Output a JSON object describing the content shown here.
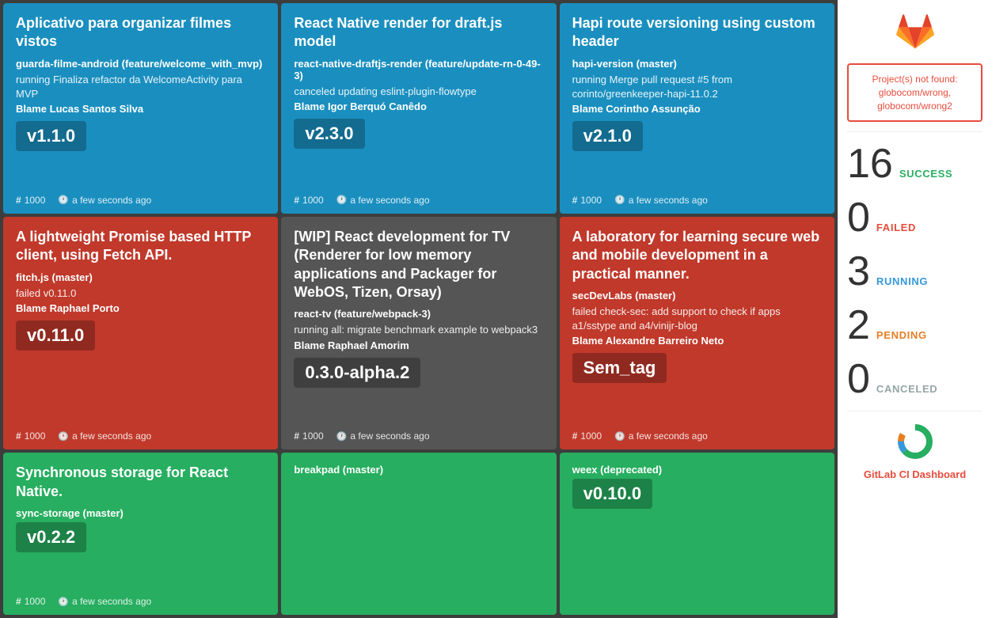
{
  "sidebar": {
    "error": {
      "text": "Project(s) not found: globocom/wrong, globocom/wrong2"
    },
    "stats": [
      {
        "number": "16",
        "label": "SUCCESS",
        "class": "success"
      },
      {
        "number": "0",
        "label": "FAILED",
        "class": "failed"
      },
      {
        "number": "3",
        "label": "RUNNING",
        "class": "running"
      },
      {
        "number": "2",
        "label": "PENDING",
        "class": "pending"
      },
      {
        "number": "0",
        "label": "CANCELED",
        "class": "canceled"
      }
    ],
    "footer_label": "GitLab CI Dashboard"
  },
  "cards": [
    {
      "id": "card-1",
      "color": "blue",
      "title": "Aplicativo para organizar filmes vistos",
      "repo": "guarda-filme-android (feature/welcome_with_mvp)",
      "desc": "running Finaliza refactor da WelcomeActivity para MVP",
      "blame": "Blame Lucas Santos Silva",
      "version": "v1.1.0",
      "issue": "1000",
      "time": "a few seconds ago"
    },
    {
      "id": "card-2",
      "color": "blue",
      "title": "React Native render for draft.js model",
      "repo": "react-native-draftjs-render (feature/update-rn-0-49-3)",
      "desc": "canceled updating eslint-plugin-flowtype",
      "blame": "Blame Igor Berquó Canêdo",
      "version": "v2.3.0",
      "issue": "1000",
      "time": "a few seconds ago"
    },
    {
      "id": "card-3",
      "color": "blue",
      "title": "Hapi route versioning using custom header",
      "repo": "hapi-version (master)",
      "desc": "running Merge pull request #5 from corinto/greenkeeper-hapi-11.0.2",
      "blame": "Blame Corintho Assunção",
      "version": "v2.1.0",
      "issue": "1000",
      "time": "a few seconds ago"
    },
    {
      "id": "card-4",
      "color": "red",
      "title": "A lightweight Promise based HTTP client, using Fetch API.",
      "repo": "fitch.js (master)",
      "desc": "failed v0.11.0",
      "blame": "Blame Raphael Porto",
      "version": "v0.11.0",
      "issue": "1000",
      "time": "a few seconds ago"
    },
    {
      "id": "card-5",
      "color": "dark",
      "title": "[WIP] React development for TV (Renderer for low memory applications and Packager for WebOS, Tizen, Orsay)",
      "repo": "react-tv (feature/webpack-3)",
      "desc": "running all: migrate benchmark example to webpack3",
      "blame": "Blame Raphael Amorim",
      "version": "0.3.0-alpha.2",
      "issue": "1000",
      "time": "a few seconds ago"
    },
    {
      "id": "card-6",
      "color": "red",
      "title": "A laboratory for learning secure web and mobile development in a practical manner.",
      "repo": "secDevLabs (master)",
      "desc": "failed check-sec: add support to check if apps a1/sstype and a4/vinijr-blog",
      "blame": "Blame Alexandre Barreiro Neto",
      "version": "Sem_tag",
      "issue": "1000",
      "time": "a few seconds ago"
    },
    {
      "id": "card-7",
      "color": "green",
      "title": "Synchronous storage for React Native.",
      "repo": "sync-storage (master)",
      "desc": "",
      "blame": "",
      "version": "v0.2.2",
      "issue": "1000",
      "time": "a few seconds ago"
    },
    {
      "id": "card-8",
      "color": "green",
      "title": "",
      "repo": "breakpad (master)",
      "desc": "",
      "blame": "",
      "version": "",
      "issue": "",
      "time": ""
    },
    {
      "id": "card-9",
      "color": "green",
      "title": "",
      "repo": "weex (deprecated)",
      "desc": "",
      "blame": "",
      "version": "v0.10.0",
      "issue": "",
      "time": ""
    }
  ]
}
